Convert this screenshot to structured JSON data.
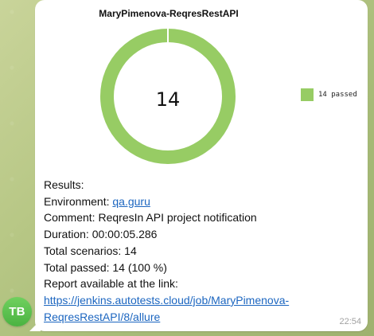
{
  "avatar": {
    "initials": "TB"
  },
  "message": {
    "chart_title": "MaryPimenova-ReqresRestAPI",
    "results_heading": "Results:",
    "environment_label": "Environment:",
    "environment_value": "qa.guru",
    "comment_label": "Comment:",
    "comment_value": "ReqresIn API project notification",
    "duration_label": "Duration:",
    "duration_value": "00:00:05.286",
    "total_scenarios_label": "Total scenarios:",
    "total_scenarios_value": "14",
    "total_passed_label": "Total passed:",
    "total_passed_value": "14 (100 %)",
    "report_label": "Report available at the link:",
    "report_link_line_1": "https://jenkins.autotests.cloud/job/MaryPimenova-",
    "report_link_line_2": "ReqresRestAPI/8/allure",
    "time": "22:54"
  },
  "chart_data": {
    "type": "pie",
    "title": "MaryPimenova-ReqresRestAPI",
    "categories": [
      "passed"
    ],
    "values": [
      14
    ],
    "center_label": "14",
    "legend": [
      "14 passed"
    ],
    "legend_position": "right",
    "colors": {
      "passed": "#97cc64",
      "separator": "#ffffff"
    }
  },
  "colors": {
    "bubble": "#ffffff",
    "link": "#1c66c0",
    "avatar": "#55b94a",
    "time": "#a2a2a2"
  }
}
